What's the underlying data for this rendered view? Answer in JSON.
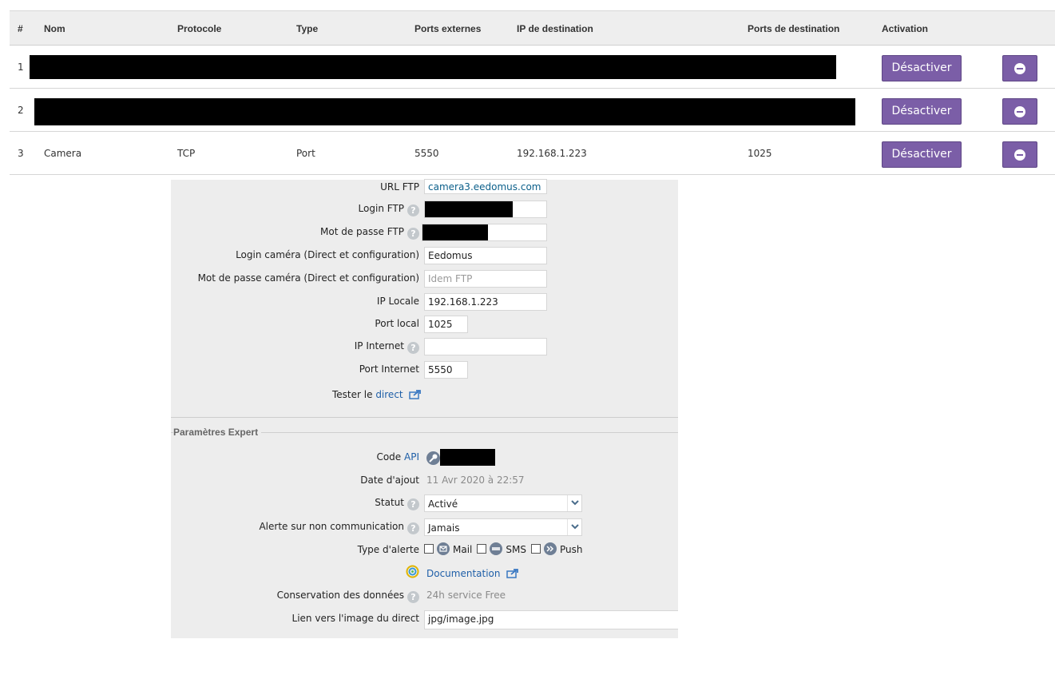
{
  "nat_table": {
    "headers": {
      "num": "#",
      "name": "Nom",
      "protocol": "Protocole",
      "type": "Type",
      "ext_ports": "Ports externes",
      "dest_ip": "IP de destination",
      "dest_ports": "Ports de destination",
      "activation": "Activation"
    },
    "rows": [
      {
        "num": "1",
        "name": "",
        "protocol": "",
        "type": "",
        "ext_ports": "",
        "dest_ip": "",
        "dest_ports": "",
        "toggle_label": "Désactiver"
      },
      {
        "num": "2",
        "name": "",
        "protocol": "",
        "type": "",
        "ext_ports": "",
        "dest_ip": "",
        "dest_ports": "",
        "toggle_label": "Désactiver"
      },
      {
        "num": "3",
        "name": "Camera",
        "protocol": "TCP",
        "type": "Port",
        "ext_ports": "5550",
        "dest_ip": "192.168.1.223",
        "dest_ports": "1025",
        "toggle_label": "Désactiver"
      }
    ]
  },
  "camera_form": {
    "url_ftp": {
      "label": "URL FTP",
      "value": "camera3.eedomus.com"
    },
    "login_ftp": {
      "label": "Login FTP",
      "value": ""
    },
    "password_ftp": {
      "label": "Mot de passe FTP",
      "value": ""
    },
    "login_camera": {
      "label": "Login caméra (Direct et configuration)",
      "value": "Eedomus"
    },
    "password_camera": {
      "label": "Mot de passe caméra (Direct et configuration)",
      "placeholder": "Idem FTP"
    },
    "ip_local": {
      "label": "IP Locale",
      "value": "192.168.1.223"
    },
    "port_local": {
      "label": "Port local",
      "value": "1025"
    },
    "ip_internet": {
      "label": "IP Internet",
      "value": ""
    },
    "port_internet": {
      "label": "Port Internet",
      "value": "5550"
    },
    "test_direct": {
      "label": "Tester le",
      "link": "direct"
    }
  },
  "expert": {
    "title": "Paramètres Expert",
    "api_code": {
      "label": "Code",
      "link": "API"
    },
    "date_added": {
      "label": "Date d'ajout",
      "value": "11 Avr 2020 à 22:57"
    },
    "status": {
      "label": "Statut",
      "value": "Activé"
    },
    "alert_noncomm": {
      "label": "Alerte sur non communication",
      "value": "Jamais"
    },
    "alert_type": {
      "label": "Type d'alerte",
      "options": [
        {
          "label": "Mail",
          "checked": false
        },
        {
          "label": "SMS",
          "checked": false
        },
        {
          "label": "Push",
          "checked": false
        }
      ]
    },
    "documentation": {
      "link": "Documentation"
    },
    "data_retention": {
      "label": "Conservation des données",
      "value": "24h service Free"
    },
    "live_image_link": {
      "label": "Lien vers l'image du direct",
      "value": "jpg/image.jpg"
    }
  },
  "colors": {
    "button": "#7b5ea7",
    "panel": "#ededed",
    "header": "#eeeeee",
    "link": "#1f5fa8"
  }
}
